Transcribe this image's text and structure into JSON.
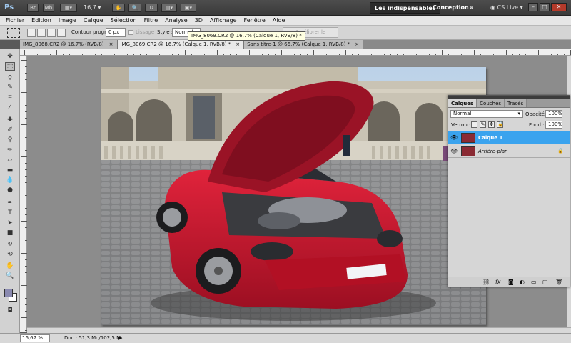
{
  "appbar": {
    "logo": "Ps",
    "bridge_label": "Br",
    "minibridge_label": "Mb",
    "zoom": "16,7",
    "workspace_essentials": "Les indispensables",
    "workspace_design": "Conception",
    "more": "»",
    "cslive": "CS Live",
    "win_minimize": "–",
    "win_restore": "□",
    "win_close": "✕"
  },
  "menu": [
    "Fichier",
    "Edition",
    "Image",
    "Calque",
    "Sélection",
    "Filtre",
    "Analyse",
    "3D",
    "Affichage",
    "Fenêtre",
    "Aide"
  ],
  "options": {
    "feather_label": "Contour progr. :",
    "feather_value": "0 px",
    "antialias_label": "Lissage",
    "style_label": "Style :",
    "style_value": "Normal",
    "refine_button": "Améliorer le contour..."
  },
  "tooltip": "IMG_8069.CR2 @ 16,7% (Calque 1, RVB/8) *",
  "tabs": [
    {
      "label": "IMG_8068.CR2 @ 16,7% (RVB/8)",
      "close": "×"
    },
    {
      "label": "IMG_8069.CR2 @ 16,7% (Calque 1, RVB/8) *",
      "close": "×"
    },
    {
      "label": "Sans titre-1 @ 66,7% (Calque 1, RVB/8) *",
      "close": "×"
    }
  ],
  "tools": [
    "move-tool-icon",
    "marquee-tool-icon",
    "lasso-tool-icon",
    "quick-select-icon",
    "crop-tool-icon",
    "eyedropper-icon",
    "heal-brush-icon",
    "brush-icon",
    "stamp-icon",
    "history-brush-icon",
    "eraser-icon",
    "gradient-icon",
    "blur-icon",
    "dodge-icon",
    "pen-icon",
    "type-icon",
    "path-select-icon",
    "shape-icon",
    "3d-rotate-icon",
    "3d-camera-icon",
    "hand-icon",
    "zoom-icon"
  ],
  "colors": {
    "foreground": "#8a8ab0",
    "background": "#ffffff",
    "selection": "#3aa3ee"
  },
  "status": {
    "zoom": "16,67 %",
    "doc_info": "Doc : 51,3 Mo/102,5 Mo",
    "arrow": "▶"
  },
  "layers_panel": {
    "tabs": [
      "Calques",
      "Couches",
      "Tracés"
    ],
    "blend_mode": "Normal",
    "opacity_label": "Opacité :",
    "opacity_value": "100%",
    "lock_label": "Verrou :",
    "fill_label": "Fond :",
    "fill_value": "100%",
    "layers": [
      {
        "name": "Calque 1",
        "selected": true
      },
      {
        "name": "Arrière-plan",
        "selected": false,
        "locked": true
      }
    ],
    "footer_icons": [
      "link-icon",
      "fx-icon",
      "mask-icon",
      "adjustment-icon",
      "group-icon",
      "new-layer-icon",
      "trash-icon"
    ],
    "footer_glyphs": [
      "⛓",
      "fx",
      "◙",
      "◐",
      "▭",
      "▢",
      "🗑"
    ]
  }
}
